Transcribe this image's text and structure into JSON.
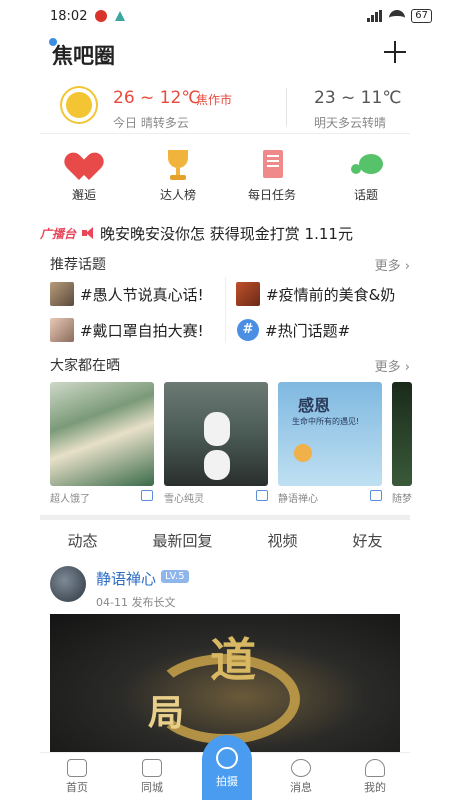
{
  "status_bar": {
    "time": "18:02",
    "battery": "67"
  },
  "header": {
    "title": "焦吧圈"
  },
  "weather": {
    "today_temp": "26 ~ 12℃",
    "city": "焦作市",
    "today_desc": "今日 晴转多云",
    "tomorrow_temp": "23 ~ 11℃",
    "tomorrow_desc": "明天多云转晴"
  },
  "quick_actions": [
    {
      "label": "邂逅",
      "icon": "hearts-icon"
    },
    {
      "label": "达人榜",
      "icon": "trophy-icon"
    },
    {
      "label": "每日任务",
      "icon": "task-book-icon"
    },
    {
      "label": "话题",
      "icon": "chat-bubble-icon"
    }
  ],
  "broadcast": {
    "tag": "广播台",
    "text": "晚安晚安没你怎 获得现金打赏 1.11元"
  },
  "recommended_topics": {
    "title": "推荐话题",
    "more": "更多",
    "items": [
      {
        "text": "#愚人节说真心话!"
      },
      {
        "text": "#疫情前的美食&奶"
      },
      {
        "text": "#戴口罩自拍大赛!"
      },
      {
        "text": "#热门话题#"
      }
    ]
  },
  "everyone_sharing": {
    "title": "大家都在晒",
    "more": "更多",
    "items": [
      {
        "author": "超人饿了"
      },
      {
        "author": "雪心纯灵"
      },
      {
        "author": "静语禅心",
        "image_text_title": "感恩",
        "image_text_sub": "生命中所有的遇见!"
      },
      {
        "author": "随梦"
      }
    ]
  },
  "feed_tabs": [
    "动态",
    "最新回复",
    "视频",
    "好友"
  ],
  "post": {
    "username": "静语禅心",
    "level": "LV.5",
    "meta": "04-11  发布长文",
    "image_chars": [
      "道",
      "局"
    ]
  },
  "bottom_nav": [
    {
      "label": "首页",
      "icon": "home-icon"
    },
    {
      "label": "同城",
      "icon": "cup-icon"
    },
    {
      "label": "拍摄",
      "icon": "camera-icon"
    },
    {
      "label": "消息",
      "icon": "message-icon"
    },
    {
      "label": "我的",
      "icon": "profile-icon"
    }
  ]
}
